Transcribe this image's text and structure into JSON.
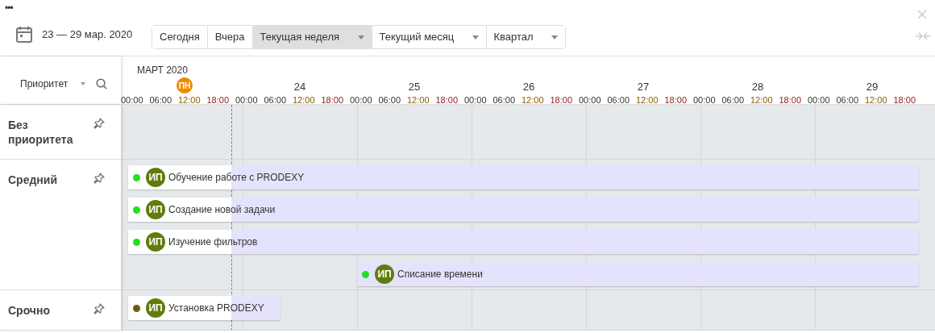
{
  "toolbar": {
    "menu": "•••",
    "date_range": "23 — 29 мар. 2020",
    "periods": [
      {
        "label": "Сегодня",
        "selected": false,
        "kind": "button"
      },
      {
        "label": "Вчера",
        "selected": false,
        "kind": "button"
      },
      {
        "label": "Текущая неделя",
        "selected": true,
        "kind": "dropdown"
      },
      {
        "label": "Текущий месяц",
        "selected": false,
        "kind": "dropdown"
      },
      {
        "label": "Квартал",
        "selected": false,
        "kind": "dropdown"
      }
    ]
  },
  "sidebar": {
    "group_by": "Приоритет"
  },
  "timeline": {
    "month": "МАРТ 2020",
    "days": [
      {
        "label": "ПН",
        "today": true,
        "hours": [
          "00:00",
          "06:00",
          "12:00",
          "18:00"
        ]
      },
      {
        "label": "24",
        "today": false,
        "hours": [
          "00:00",
          "06:00",
          "12:00",
          "18:00"
        ]
      },
      {
        "label": "25",
        "today": false,
        "hours": [
          "00:00",
          "06:00",
          "12:00",
          "18:00"
        ]
      },
      {
        "label": "26",
        "today": false,
        "hours": [
          "00:00",
          "06:00",
          "12:00",
          "18:00"
        ]
      },
      {
        "label": "27",
        "today": false,
        "hours": [
          "00:00",
          "06:00",
          "12:00",
          "18:00"
        ]
      },
      {
        "label": "28",
        "today": false,
        "hours": [
          "00:00",
          "06:00",
          "12:00",
          "18:00"
        ]
      },
      {
        "label": "29",
        "today": false,
        "hours": [
          "00:00",
          "06:00",
          "12:00",
          "18:00"
        ]
      }
    ]
  },
  "groups": [
    {
      "name": "Без приоритета"
    },
    {
      "name": "Средний",
      "tasks": [
        {
          "title": "Обучение работе с PRODEXY",
          "assignee": "ИП",
          "color": "#22e01f"
        },
        {
          "title": "Создание новой задачи",
          "assignee": "ИП",
          "color": "#22e01f"
        },
        {
          "title": "Изучение фильтров",
          "assignee": "ИП",
          "color": "#22e01f"
        },
        {
          "title": "Списание времени",
          "assignee": "ИП",
          "color": "#22e01f"
        }
      ]
    },
    {
      "name": "Срочно",
      "tasks": [
        {
          "title": "Установка PRODEXY",
          "assignee": "ИП",
          "color": "#6b5a10"
        }
      ]
    }
  ]
}
